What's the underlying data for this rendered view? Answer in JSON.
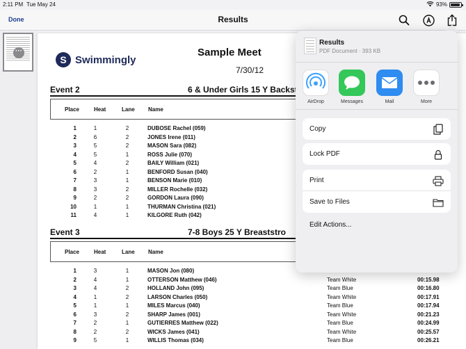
{
  "status_bar": {
    "time": "2:11 PM",
    "date": "Tue May 24",
    "battery": "93%",
    "battery_level": 0.93
  },
  "nav": {
    "done_label": "Done",
    "title": "Results",
    "icons": [
      "search-icon",
      "markup-icon",
      "share-icon"
    ]
  },
  "document": {
    "brand": "Swimmingly",
    "meet_title": "Sample Meet",
    "meet_date": "7/30/12",
    "columns": {
      "place": "Place",
      "heat": "Heat",
      "lane": "Lane",
      "name": "Name"
    },
    "events": [
      {
        "label": "Event 2",
        "description": "6 & Under Girls 15 Y Backst",
        "rows": [
          {
            "place": "1",
            "heat": "1",
            "lane": "2",
            "name": "DUBOSE Rachel (059)"
          },
          {
            "place": "2",
            "heat": "6",
            "lane": "2",
            "name": "JONES Irene (011)"
          },
          {
            "place": "3",
            "heat": "5",
            "lane": "2",
            "name": "MASON Sara (082)"
          },
          {
            "place": "4",
            "heat": "5",
            "lane": "1",
            "name": "ROSS Julie (070)"
          },
          {
            "place": "5",
            "heat": "4",
            "lane": "2",
            "name": "BAILY William (021)"
          },
          {
            "place": "6",
            "heat": "2",
            "lane": "1",
            "name": "BENFORD Susan (040)"
          },
          {
            "place": "7",
            "heat": "3",
            "lane": "1",
            "name": "BENSON Marie (010)"
          },
          {
            "place": "8",
            "heat": "3",
            "lane": "2",
            "name": "MILLER Rochelle (032)"
          },
          {
            "place": "9",
            "heat": "2",
            "lane": "2",
            "name": "GORDON Laura (090)"
          },
          {
            "place": "10",
            "heat": "1",
            "lane": "1",
            "name": "THURMAN Christina (021)"
          },
          {
            "place": "11",
            "heat": "4",
            "lane": "1",
            "name": "KILGORE Ruth (042)"
          }
        ]
      },
      {
        "label": "Event 3",
        "description": "7-8 Boys 25 Y Breaststro",
        "rows": [
          {
            "place": "1",
            "heat": "3",
            "lane": "1",
            "name": "MASON Jon (080)",
            "team": "",
            "time": ""
          },
          {
            "place": "2",
            "heat": "4",
            "lane": "1",
            "name": "OTTERSON Matthew (046)",
            "team": "Team White",
            "time": "00:15.98"
          },
          {
            "place": "3",
            "heat": "4",
            "lane": "2",
            "name": "HOLLAND John (095)",
            "team": "Team Blue",
            "time": "00:16.80"
          },
          {
            "place": "4",
            "heat": "1",
            "lane": "2",
            "name": "LARSON Charles (050)",
            "team": "Team White",
            "time": "00:17.91"
          },
          {
            "place": "5",
            "heat": "1",
            "lane": "1",
            "name": "MILES Marcus (040)",
            "team": "Team Blue",
            "time": "00:17.94"
          },
          {
            "place": "6",
            "heat": "3",
            "lane": "2",
            "name": "SHARP James (001)",
            "team": "Team White",
            "time": "00:21.23"
          },
          {
            "place": "7",
            "heat": "2",
            "lane": "1",
            "name": "GUTIERRES Matthew (022)",
            "team": "Team Blue",
            "time": "00:24.99"
          },
          {
            "place": "8",
            "heat": "2",
            "lane": "2",
            "name": "WICKS James (041)",
            "team": "Team White",
            "time": "00:25.57"
          },
          {
            "place": "9",
            "heat": "5",
            "lane": "1",
            "name": "WILLIS Thomas (034)",
            "team": "Team Blue",
            "time": "00:26.21"
          }
        ]
      }
    ]
  },
  "share_sheet": {
    "file_name": "Results",
    "file_meta": "PDF Document · 393 KB",
    "apps": [
      {
        "label": "AirDrop",
        "icon": "airdrop-icon"
      },
      {
        "label": "Messages",
        "icon": "messages-icon"
      },
      {
        "label": "Mail",
        "icon": "mail-icon"
      },
      {
        "label": "More",
        "icon": "more-icon"
      }
    ],
    "actions": {
      "copy": "Copy",
      "lock_pdf": "Lock PDF",
      "print": "Print",
      "save_to_files": "Save to Files",
      "edit_actions": "Edit Actions..."
    }
  },
  "colors": {
    "accent": "#1c3d8c",
    "brand": "#1e2a5a",
    "airdrop": "#3aa0ff",
    "messages": "#34c759",
    "mail": "#2f8cf0"
  }
}
